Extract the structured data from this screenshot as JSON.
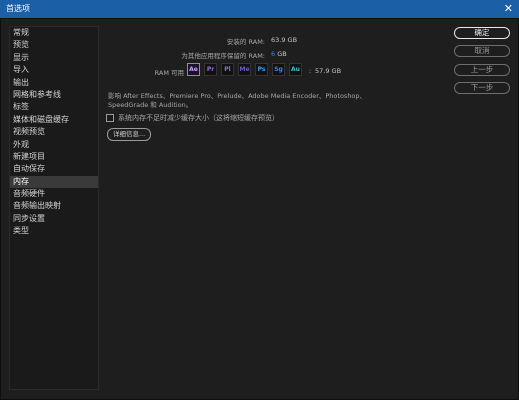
{
  "window": {
    "title": "首选项",
    "close_glyph": "✕"
  },
  "sidebar": {
    "items": [
      {
        "label": "常规"
      },
      {
        "label": "预览"
      },
      {
        "label": "显示"
      },
      {
        "label": "导入"
      },
      {
        "label": "输出"
      },
      {
        "label": "网格和参考线"
      },
      {
        "label": "标签"
      },
      {
        "label": "媒体和磁盘缓存"
      },
      {
        "label": "视频预览"
      },
      {
        "label": "外观"
      },
      {
        "label": "新建项目"
      },
      {
        "label": "自动保存"
      },
      {
        "label": "内存"
      },
      {
        "label": "音频硬件"
      },
      {
        "label": "音频输出映射"
      },
      {
        "label": "同步设置"
      },
      {
        "label": "类型"
      }
    ],
    "selected_label": "内存"
  },
  "memory": {
    "installed_label": "安装的 RAM:",
    "installed_value": "63.9 GB",
    "reserved_label": "为其他应用程序保留的 RAM:",
    "reserved_value": "6",
    "reserved_unit": "GB",
    "available_label": "RAM 可用",
    "available_value": "57.9 GB",
    "available_sep": ":",
    "affects_text_line1": "影响 After Effects、Premiere Pro、Prelude、Adobe Media Encoder、Photoshop、",
    "affects_text_line2": "SpeedGrade 和 Audition。",
    "reduce_cache_label": "系统内存不足时减少缓存大小（这将缩短缓存预览）",
    "details_button_label": "详细信息..."
  },
  "app_icons": [
    {
      "abbr": "Ae",
      "color": "#c7a2ff"
    },
    {
      "abbr": "Pr",
      "color": "#9a6bd8"
    },
    {
      "abbr": "Pl",
      "color": "#6f7fe0"
    },
    {
      "abbr": "Me",
      "color": "#6a5acd"
    },
    {
      "abbr": "Ps",
      "color": "#2fa3ff"
    },
    {
      "abbr": "Sg",
      "color": "#2e8bff"
    },
    {
      "abbr": "Au",
      "color": "#3fbfcf"
    }
  ],
  "buttons": {
    "ok": "确定",
    "cancel": "取消",
    "prev": "上一步",
    "next": "下一步"
  },
  "colors": {
    "title_bar": "#1b5fa6",
    "accent": "#2d8ceb"
  }
}
